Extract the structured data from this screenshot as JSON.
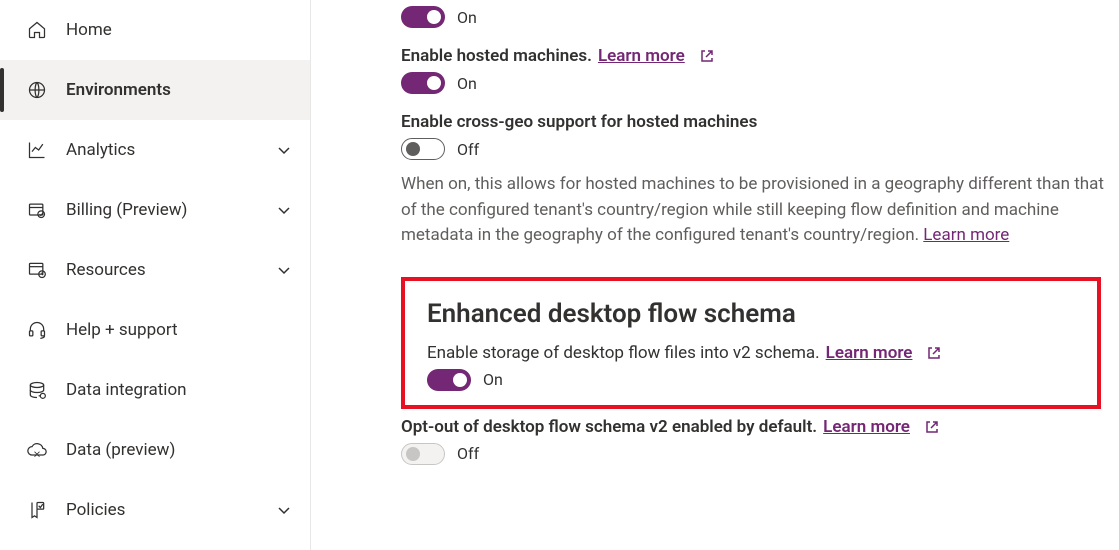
{
  "sidebar": {
    "items": [
      {
        "label": "Home",
        "expandable": false
      },
      {
        "label": "Environments",
        "expandable": false,
        "active": true
      },
      {
        "label": "Analytics",
        "expandable": true
      },
      {
        "label": "Billing (Preview)",
        "expandable": true
      },
      {
        "label": "Resources",
        "expandable": true
      },
      {
        "label": "Help + support",
        "expandable": false
      },
      {
        "label": "Data integration",
        "expandable": false
      },
      {
        "label": "Data (preview)",
        "expandable": false
      },
      {
        "label": "Policies",
        "expandable": true
      }
    ]
  },
  "settings": {
    "s0": {
      "state": "on",
      "state_label": "On"
    },
    "s1": {
      "title": "Enable hosted machines.",
      "learn": "Learn more",
      "state": "on",
      "state_label": "On"
    },
    "s2": {
      "title": "Enable cross-geo support for hosted machines",
      "state": "off",
      "state_label": "Off",
      "desc": "When on, this allows for hosted machines to be provisioned in a geography different than that of the configured tenant's country/region while still keeping flow definition and machine metadata in the geography of the configured tenant's country/region.",
      "desc_learn": "Learn more"
    },
    "section_heading": "Enhanced desktop flow schema",
    "s3": {
      "title": "Enable storage of desktop flow files into v2 schema.",
      "learn": "Learn more",
      "state": "on",
      "state_label": "On"
    },
    "s4": {
      "title": "Opt-out of desktop flow schema v2 enabled by default.",
      "learn": "Learn more",
      "state": "disabled",
      "state_label": "Off"
    }
  }
}
